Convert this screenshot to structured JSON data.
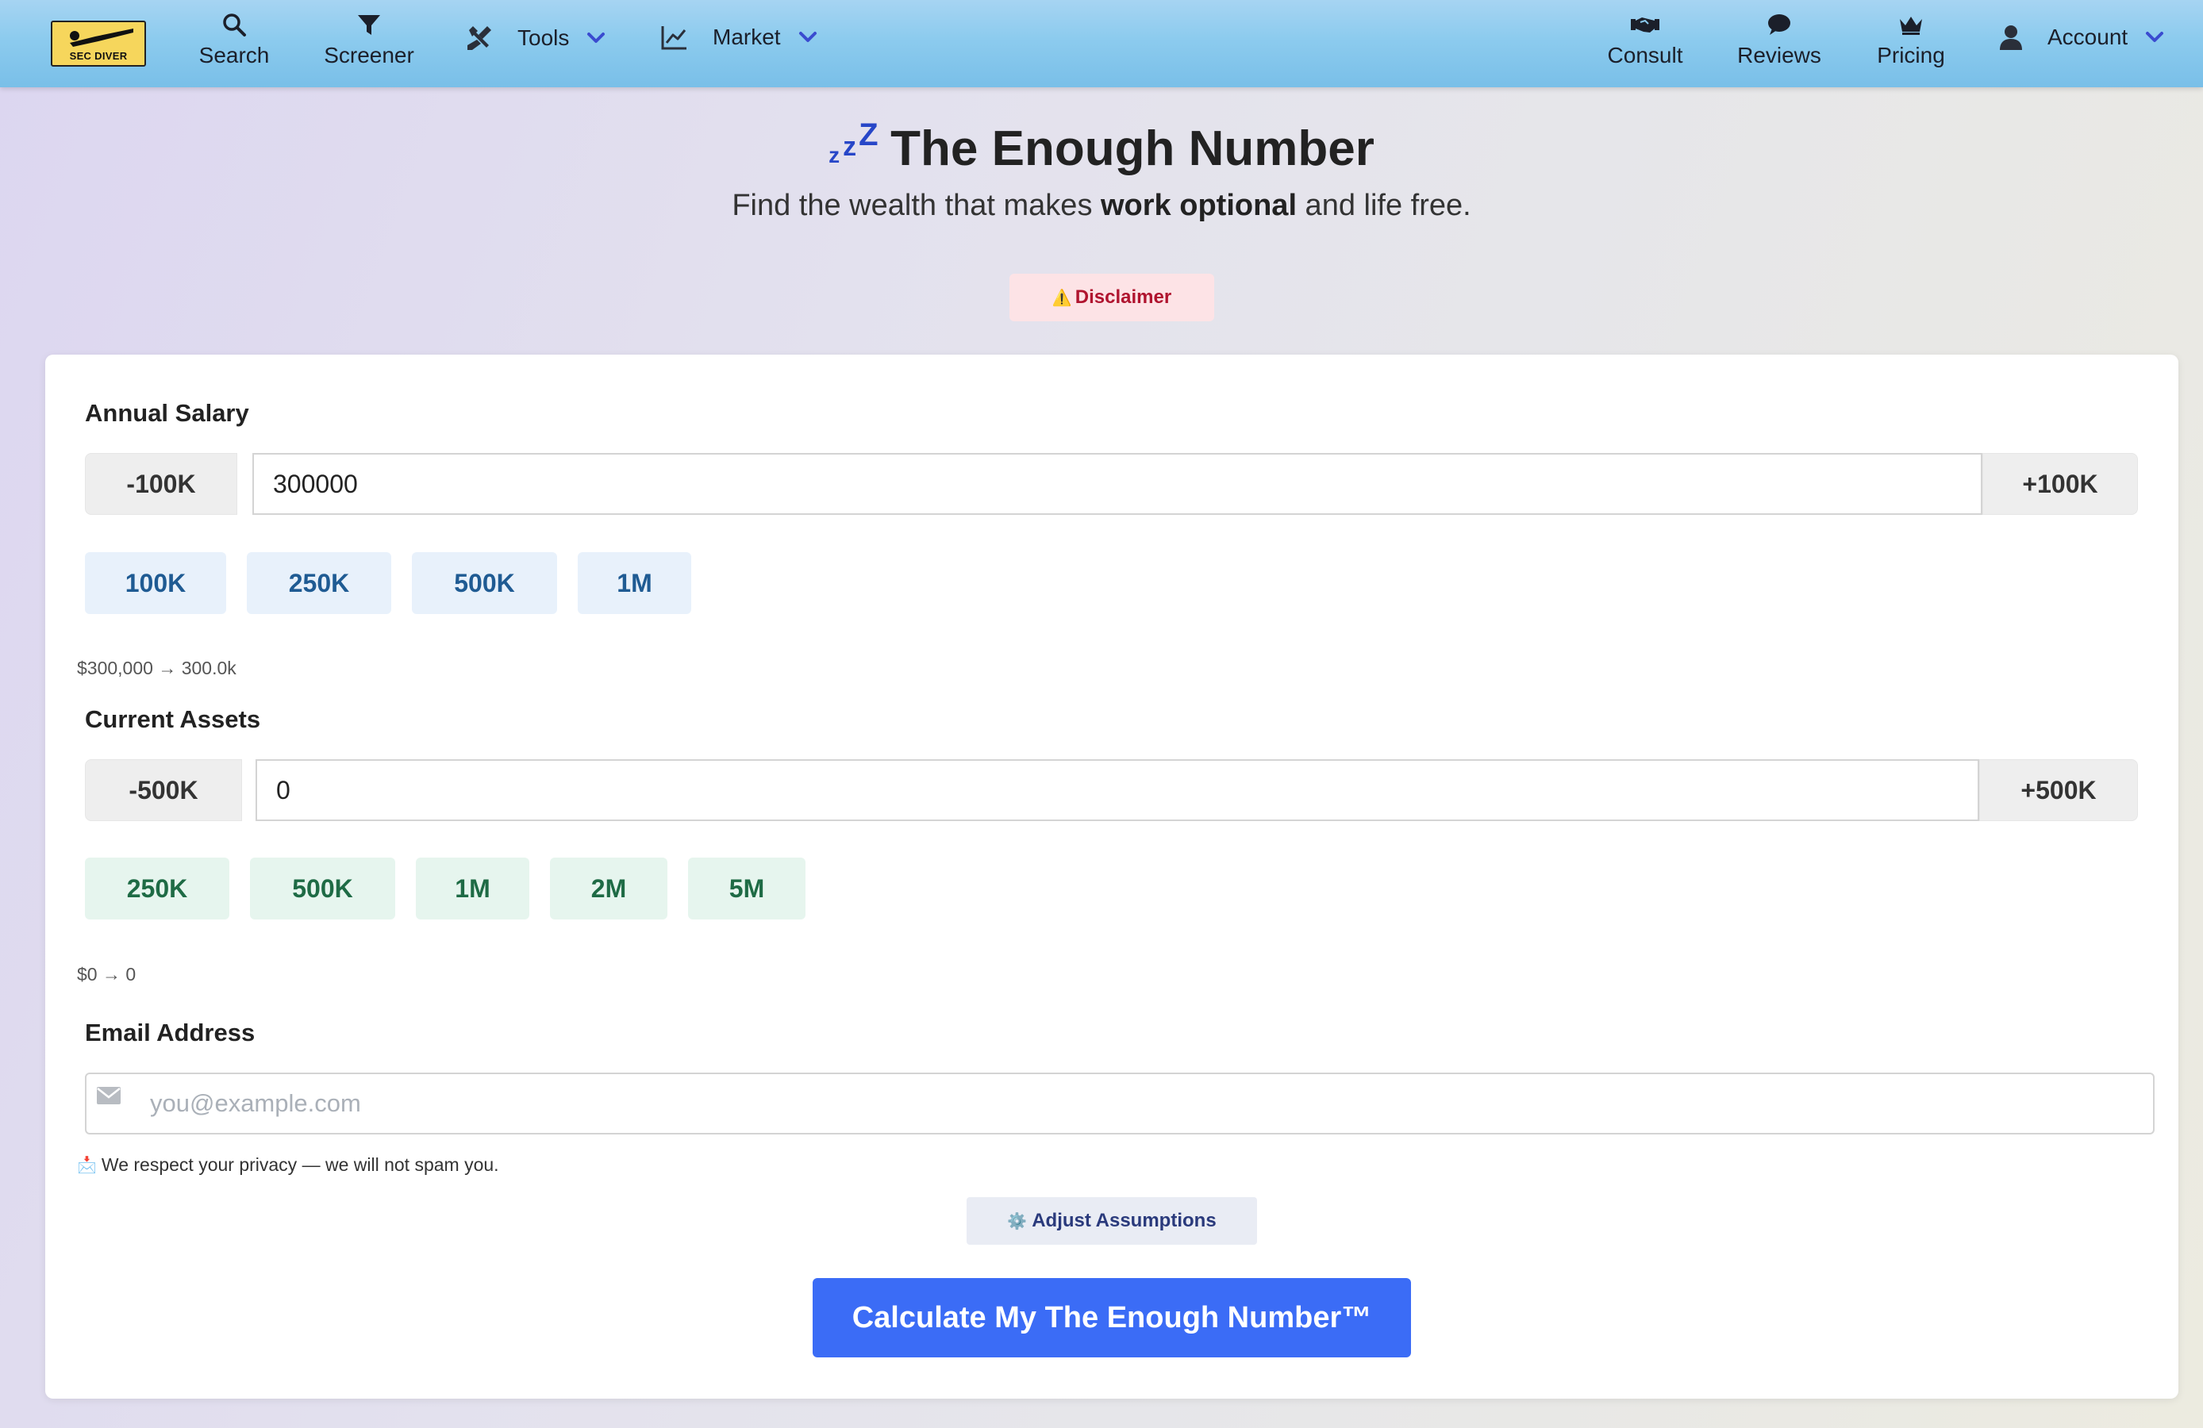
{
  "nav": {
    "logo_text": "SEC DIVER",
    "search": "Search",
    "screener": "Screener",
    "tools": "Tools",
    "market": "Market",
    "consult": "Consult",
    "reviews": "Reviews",
    "pricing": "Pricing",
    "account": "Account"
  },
  "hero": {
    "zzz": "zzZ",
    "title": "The Enough Number",
    "subtitle_pre": "Find the wealth that makes ",
    "subtitle_bold": "work optional",
    "subtitle_post": " and life free.",
    "disclaimer": "Disclaimer",
    "disclaimer_icon": "⚠️"
  },
  "salary": {
    "label": "Annual Salary",
    "minus": "-100K",
    "plus": "+100K",
    "value": "300000",
    "presets": [
      "100K",
      "250K",
      "500K",
      "1M"
    ],
    "hint": "$300,000 → 300.0k"
  },
  "assets": {
    "label": "Current Assets",
    "minus": "-500K",
    "plus": "+500K",
    "value": "0",
    "presets": [
      "250K",
      "500K",
      "1M",
      "2M",
      "5M"
    ],
    "hint": "$0 → 0"
  },
  "email": {
    "label": "Email Address",
    "placeholder": "you@example.com",
    "privacy": "We respect your privacy — we will not spam you.",
    "privacy_icon": "📩"
  },
  "actions": {
    "adjust_icon": "⚙️",
    "adjust": "Adjust Assumptions",
    "calculate": "Calculate My The Enough Number™"
  },
  "colors": {
    "primary_button": "#3b6cf6",
    "disclaimer_bg": "#fde3e6",
    "disclaimer_text": "#b0142f",
    "salary_chip_bg": "#e8f1fb",
    "assets_chip_bg": "#e6f5ee"
  }
}
